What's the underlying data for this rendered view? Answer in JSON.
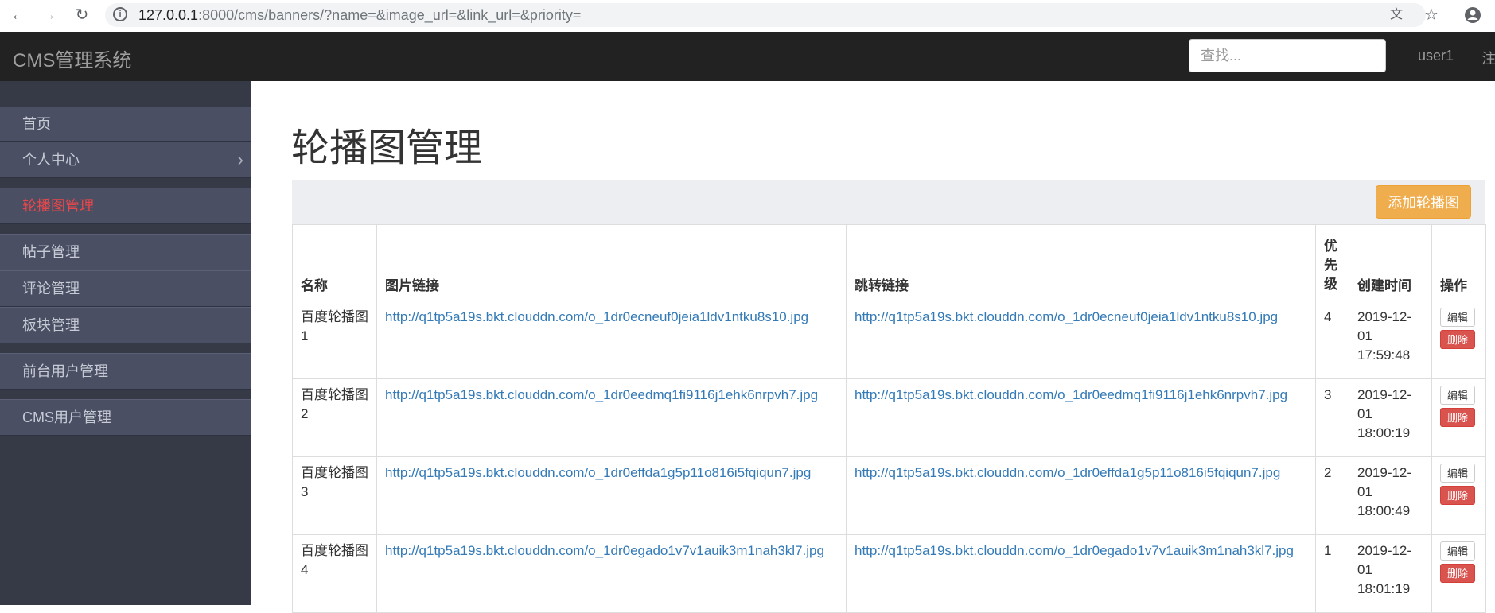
{
  "browser": {
    "url_host": "127.0.0.1",
    "url_rest": ":8000/cms/banners/?name=&image_url=&link_url=&priority="
  },
  "navbar": {
    "brand": "CMS管理系统",
    "search_placeholder": "查找...",
    "user": "user1",
    "logout": "注"
  },
  "sidebar": {
    "items": [
      {
        "label": "首页"
      },
      {
        "label": "个人中心"
      },
      {
        "label": "轮播图管理"
      },
      {
        "label": "帖子管理"
      },
      {
        "label": "评论管理"
      },
      {
        "label": "板块管理"
      },
      {
        "label": "前台用户管理"
      },
      {
        "label": "CMS用户管理"
      }
    ]
  },
  "main": {
    "title": "轮播图管理",
    "add_button": "添加轮播图",
    "table": {
      "headers": [
        "名称",
        "图片链接",
        "跳转链接",
        "优先级",
        "创建时间",
        "操作"
      ],
      "edit_label": "编辑",
      "delete_label": "删除",
      "rows": [
        {
          "name": "百度轮播图1",
          "image_url": "http://q1tp5a19s.bkt.clouddn.com/o_1dr0ecneuf0jeia1ldv1ntku8s10.jpg",
          "link_url": "http://q1tp5a19s.bkt.clouddn.com/o_1dr0ecneuf0jeia1ldv1ntku8s10.jpg",
          "priority": "4",
          "created": "2019-12-01 17:59:48"
        },
        {
          "name": "百度轮播图2",
          "image_url": "http://q1tp5a19s.bkt.clouddn.com/o_1dr0eedmq1fi9116j1ehk6nrpvh7.jpg",
          "link_url": "http://q1tp5a19s.bkt.clouddn.com/o_1dr0eedmq1fi9116j1ehk6nrpvh7.jpg",
          "priority": "3",
          "created": "2019-12-01 18:00:19"
        },
        {
          "name": "百度轮播图3",
          "image_url": "http://q1tp5a19s.bkt.clouddn.com/o_1dr0effda1g5p11o816i5fqiqun7.jpg",
          "link_url": "http://q1tp5a19s.bkt.clouddn.com/o_1dr0effda1g5p11o816i5fqiqun7.jpg",
          "priority": "2",
          "created": "2019-12-01 18:00:49"
        },
        {
          "name": "百度轮播图4",
          "image_url": "http://q1tp5a19s.bkt.clouddn.com/o_1dr0egado1v7v1auik3m1nah3kl7.jpg",
          "link_url": "http://q1tp5a19s.bkt.clouddn.com/o_1dr0egado1v7v1auik3m1nah3kl7.jpg",
          "priority": "1",
          "created": "2019-12-01 18:01:19"
        }
      ]
    }
  },
  "colors": {
    "navbar_bg": "#222222",
    "sidebar_bg": "#363a47",
    "sidebar_item_bg": "#4a4f63",
    "active_item": "#e8474b",
    "add_button": "#f0ad4e",
    "delete_button": "#d9534f",
    "link": "#337ab7"
  }
}
